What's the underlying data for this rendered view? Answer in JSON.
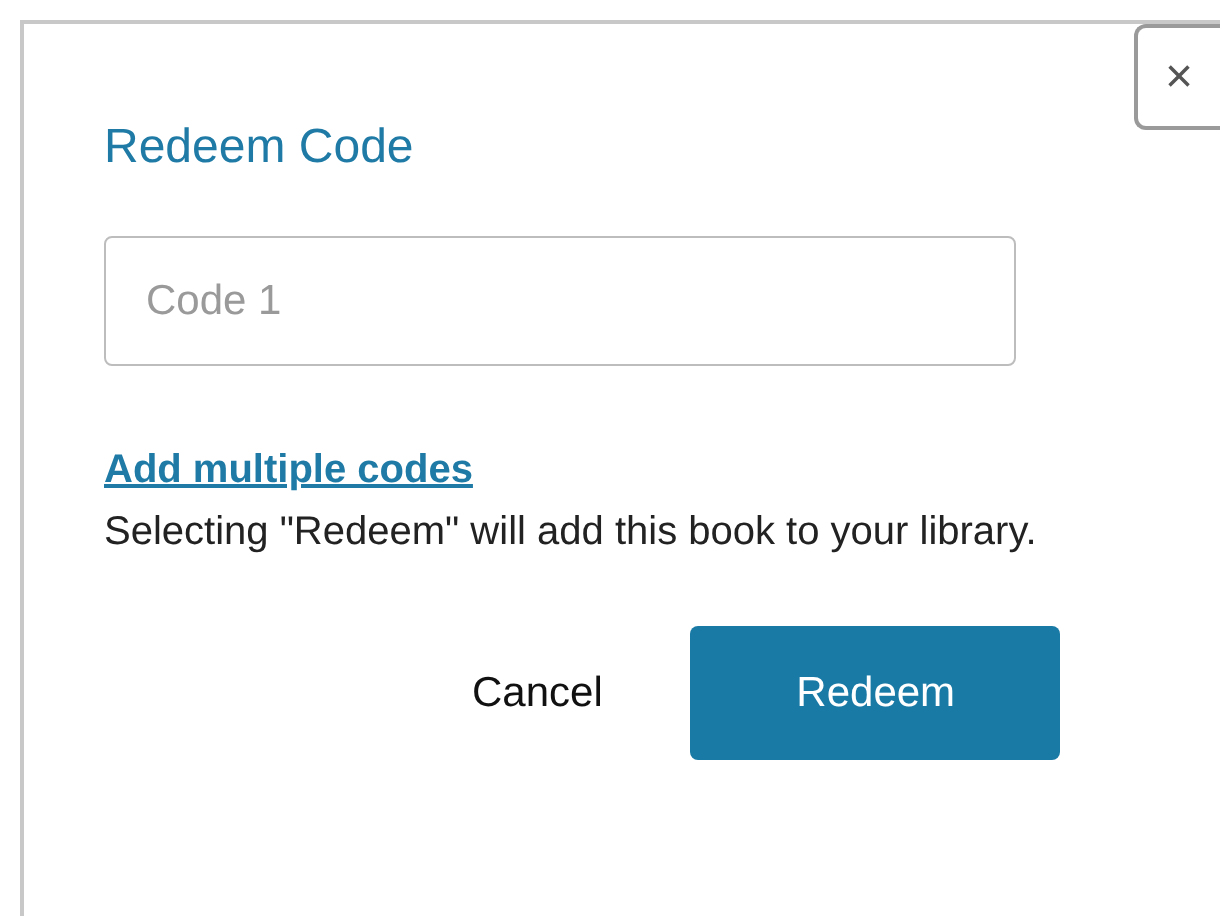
{
  "dialog": {
    "title": "Redeem Code",
    "close_label": "×",
    "code_field": {
      "placeholder": "Code 1"
    },
    "link": "Add multiple codes",
    "message": "Selecting \"Redeem\" will add this book to your library.",
    "buttons": [
      {
        "label": "Cancel",
        "kind": "secondary"
      },
      {
        "label": "Redeem",
        "kind": "primary"
      }
    ]
  }
}
